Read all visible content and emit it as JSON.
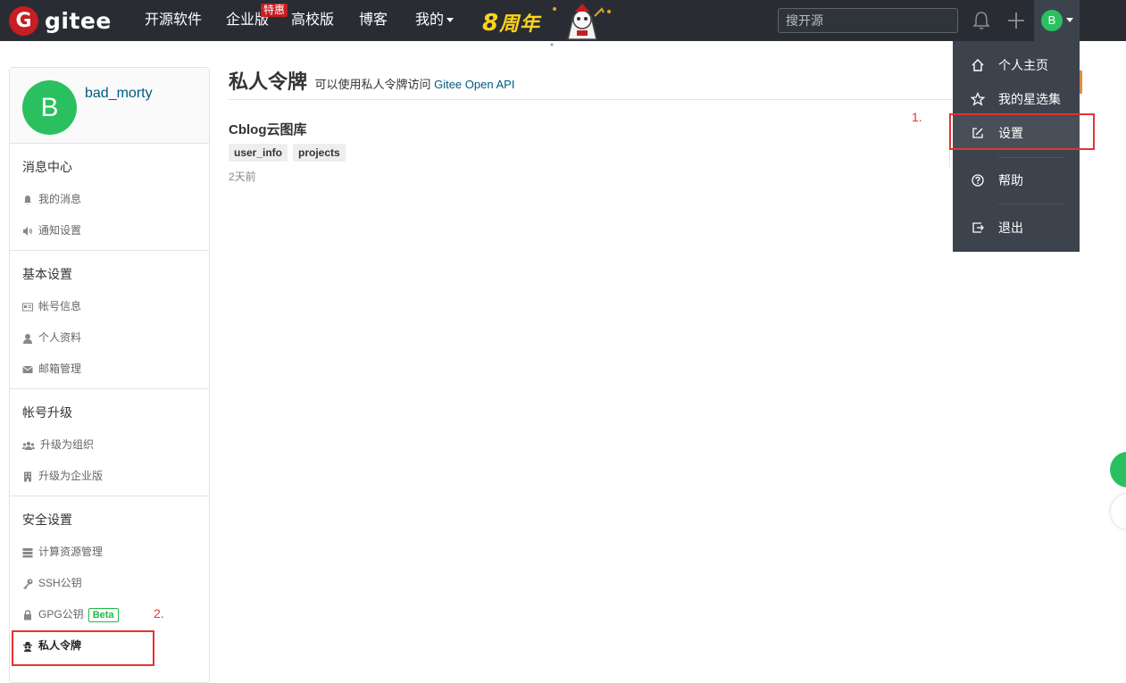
{
  "topbar": {
    "logo_mark": "G",
    "logo_text": "gitee",
    "nav": [
      {
        "label": "开源软件"
      },
      {
        "label": "企业版"
      },
      {
        "label": "高校版"
      },
      {
        "label": "博客"
      },
      {
        "label": "我的"
      }
    ],
    "enterprise_badge": "特惠",
    "anniversary_num": "8",
    "anniversary_text": "周年",
    "search_placeholder": "搜开源",
    "avatar_letter": "B"
  },
  "sidebar": {
    "avatar_letter": "B",
    "username": "bad_morty",
    "sections": [
      {
        "title": "消息中心",
        "items": [
          {
            "label": "我的消息",
            "icon": "bell-icon"
          },
          {
            "label": "通知设置",
            "icon": "volume-icon"
          }
        ]
      },
      {
        "title": "基本设置",
        "items": [
          {
            "label": "帐号信息",
            "icon": "id-card-icon"
          },
          {
            "label": "个人资料",
            "icon": "user-icon"
          },
          {
            "label": "邮箱管理",
            "icon": "mail-icon"
          }
        ]
      },
      {
        "title": "帐号升级",
        "items": [
          {
            "label": "升级为组织",
            "icon": "users-icon"
          },
          {
            "label": "升级为企业版",
            "icon": "building-icon"
          }
        ]
      },
      {
        "title": "安全设置",
        "items": [
          {
            "label": "计算资源管理",
            "icon": "server-icon"
          },
          {
            "label": "SSH公钥",
            "icon": "key-icon"
          },
          {
            "label": "GPG公钥",
            "icon": "lock-icon",
            "badge": "Beta"
          },
          {
            "label": "私人令牌",
            "icon": "spy-icon",
            "active": true
          }
        ]
      }
    ]
  },
  "main": {
    "title": "私人令牌",
    "subtitle_prefix": "可以使用私人令牌访问 ",
    "subtitle_link": "Gitee Open API",
    "token": {
      "name": "Cblog云图库",
      "scopes": [
        "user_info",
        "projects"
      ],
      "time": "2天前"
    }
  },
  "dropdown": {
    "items": [
      {
        "label": "个人主页",
        "icon": "home-icon"
      },
      {
        "label": "我的星选集",
        "icon": "star-icon"
      },
      {
        "label": "设置",
        "icon": "edit-icon"
      },
      {
        "label": "帮助",
        "icon": "help-icon"
      },
      {
        "label": "退出",
        "icon": "logout-icon"
      }
    ]
  },
  "annotations": {
    "step1": "1.",
    "step2": "2."
  }
}
